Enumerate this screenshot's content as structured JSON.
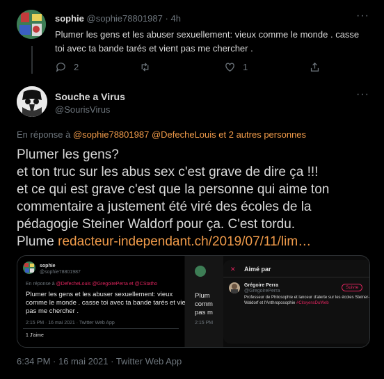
{
  "tweet1": {
    "name": "sophie",
    "handle": "@sophie78801987",
    "dot": "·",
    "time": "4h",
    "text_line1": "Plumer les gens et les abuser sexuellement: vieux comme le monde . casse",
    "text_line2": "toi avec ta bande tarés et vient pas me chercher .",
    "reply_count": "2",
    "like_count": "1"
  },
  "tweet2": {
    "name": "Souche a Virus",
    "handle": "@SourisVirus",
    "reply_prefix": "En réponse à",
    "reply_to_1": "@sophie78801987",
    "reply_to_2": "@DefecheLouis",
    "reply_and": "et 2 autres personnes",
    "lines": [
      "Plumer les gens?",
      "et ton truc sur les abus sex c'est grave de dire ça !!!",
      "et ce qui est grave c'est que la personne qui aime ton",
      "commentaire a justement été viré des écoles de la",
      "pédagogie Steiner Waldorf pour ça. C'est tordu."
    ],
    "last_line_prefix": "Plume",
    "link_text": "redacteur-independant.ch/2019/07/11/lim…",
    "footer": "6:34 PM · 16 mai 2021 · Twitter Web App"
  },
  "embed": {
    "name": "sophie",
    "handle": "@sophie78801987",
    "reply_prefix": "En réponse à",
    "reply_to": "@DefecheLouis @GregoirePerra  et  @CStatho",
    "text_line1": "Plumer les gens et les abuser sexuellement: vieux",
    "text_line2": "comme le monde . casse toi avec ta bande tarés et vient",
    "text_line3": "pas me chercher .",
    "footer": "2:15 PM · 16 mai 2021 · Twitter Web App",
    "likes": "1 J'aime",
    "mid_lines": [
      "Plum",
      "comm",
      "pas m"
    ],
    "mid_footer": "2:15 PM",
    "panel_close": "✕",
    "panel_title": "Aimé par",
    "liker_name": "Grégoire Perra",
    "liker_handle": "@GregoirePerra",
    "liker_bio1": "Professeur de Philosophie et lanceur d'alerte sur les écoles Steiner-",
    "liker_bio2": "Waldorf et l'Anthroposophie",
    "liker_tag": "#CitoyensDuWeb",
    "follow_label": "Suivre"
  },
  "colors": {
    "background": "#000000",
    "text": "#d9d9d9",
    "muted": "#6e767d",
    "link": "#f09b4a",
    "accent_red": "#e0245e"
  },
  "icons": [
    "reply-icon",
    "retweet-icon",
    "like-icon",
    "share-icon",
    "more-icon"
  ]
}
